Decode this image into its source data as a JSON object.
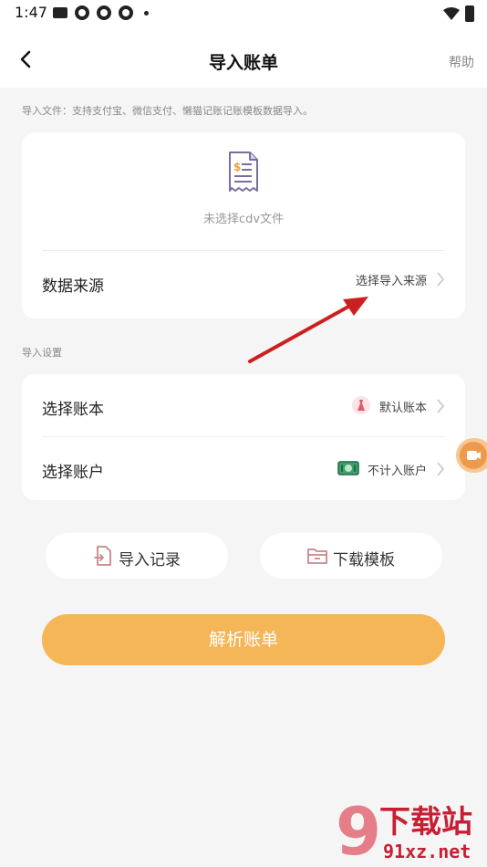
{
  "status": {
    "time": "1:47"
  },
  "header": {
    "title": "导入账单",
    "help": "帮助"
  },
  "import_hint": "导入文件：支持支付宝、微信支付、懒猫记账记账模板数据导入。",
  "file_card": {
    "no_file_text": "未选择cdv文件",
    "source_label": "数据来源",
    "source_value": "选择导入来源"
  },
  "settings": {
    "section_label": "导入设置",
    "book_label": "选择账本",
    "book_value": "默认账本",
    "account_label": "选择账户",
    "account_value": "不计入账户"
  },
  "actions": {
    "history_label": "导入记录",
    "template_label": "下载模板",
    "parse_label": "解析账单"
  },
  "watermark": {
    "line1": "下载站",
    "line2": "91xz.net"
  },
  "colors": {
    "accent": "#f4b657",
    "arrow": "#cc2020"
  }
}
